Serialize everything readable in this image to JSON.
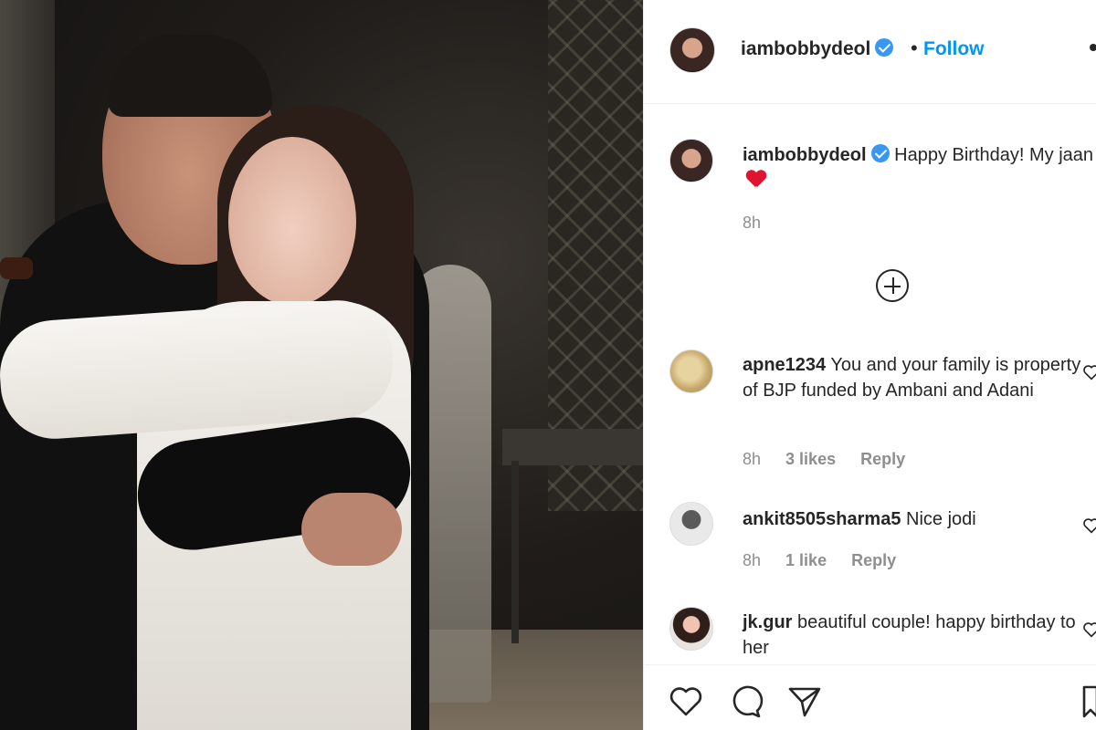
{
  "post": {
    "username": "iambobbydeol",
    "follow_label": "Follow",
    "separator": "•"
  },
  "caption": {
    "username": "iambobbydeol",
    "text": "Happy Birthday! My jaan",
    "time": "8h"
  },
  "comments": [
    {
      "username": "apne1234",
      "text": "You and your family is property of BJP funded by Ambani and Adani",
      "time": "8h",
      "likes": "3 likes",
      "reply": "Reply"
    },
    {
      "username": "ankit8505sharma5",
      "text": "Nice jodi",
      "time": "8h",
      "likes": "1 like",
      "reply": "Reply"
    },
    {
      "username": "jk.gur",
      "text": "beautiful couple! happy birthday to her",
      "time": "",
      "likes": "",
      "reply": ""
    }
  ],
  "icons": {
    "more": "more-options-icon",
    "verified": "verified-badge-icon",
    "load_more": "load-more-comments-icon",
    "like": "heart-icon",
    "comment": "comment-icon",
    "share": "share-icon",
    "save": "bookmark-icon"
  },
  "colors": {
    "follow": "#0095f6",
    "verified": "#3897f0",
    "meta_text": "#8e8e8e",
    "emoji_heart": "#e0142e"
  }
}
